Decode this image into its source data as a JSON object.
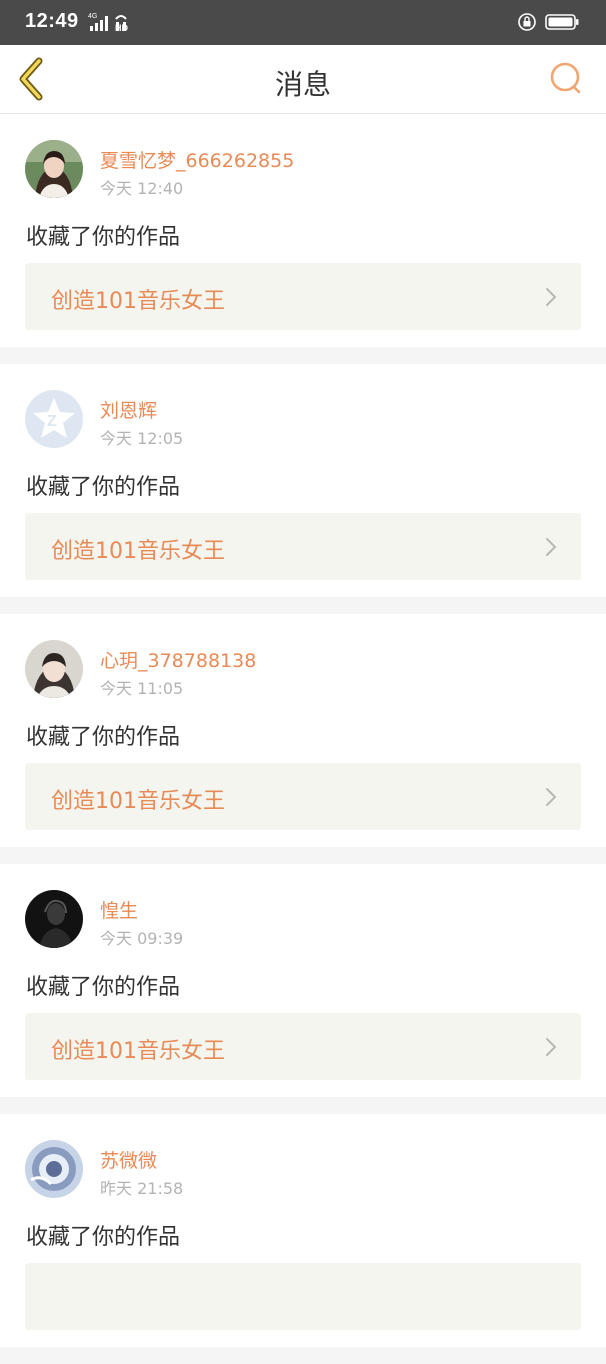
{
  "status_bar": {
    "time": "12:49",
    "network": "4G",
    "hd": "HD",
    "icons": [
      "signal-icon",
      "hd-call-icon",
      "rotation-lock-icon",
      "battery-icon"
    ]
  },
  "header": {
    "title": "消息",
    "back_icon": "chevron-left-icon",
    "search_icon": "search-icon",
    "accent_color": "#e88a55"
  },
  "colors": {
    "accent": "#e88a55",
    "text": "#333333",
    "muted": "#b3b3b3",
    "card_bg": "#f5f5ef"
  },
  "messages": [
    {
      "username": "夏雪忆梦_666262855",
      "time": "今天 12:40",
      "action": "收藏了你的作品",
      "work": "创造101音乐女王"
    },
    {
      "username": "刘恩辉",
      "time": "今天 12:05",
      "action": "收藏了你的作品",
      "work": "创造101音乐女王"
    },
    {
      "username": "心玥_378788138",
      "time": "今天 11:05",
      "action": "收藏了你的作品",
      "work": "创造101音乐女王"
    },
    {
      "username": "惶生",
      "time": "今天 09:39",
      "action": "收藏了你的作品",
      "work": "创造101音乐女王"
    },
    {
      "username": "苏微微",
      "time": "昨天 21:58",
      "action": "收藏了你的作品",
      "work": ""
    }
  ]
}
